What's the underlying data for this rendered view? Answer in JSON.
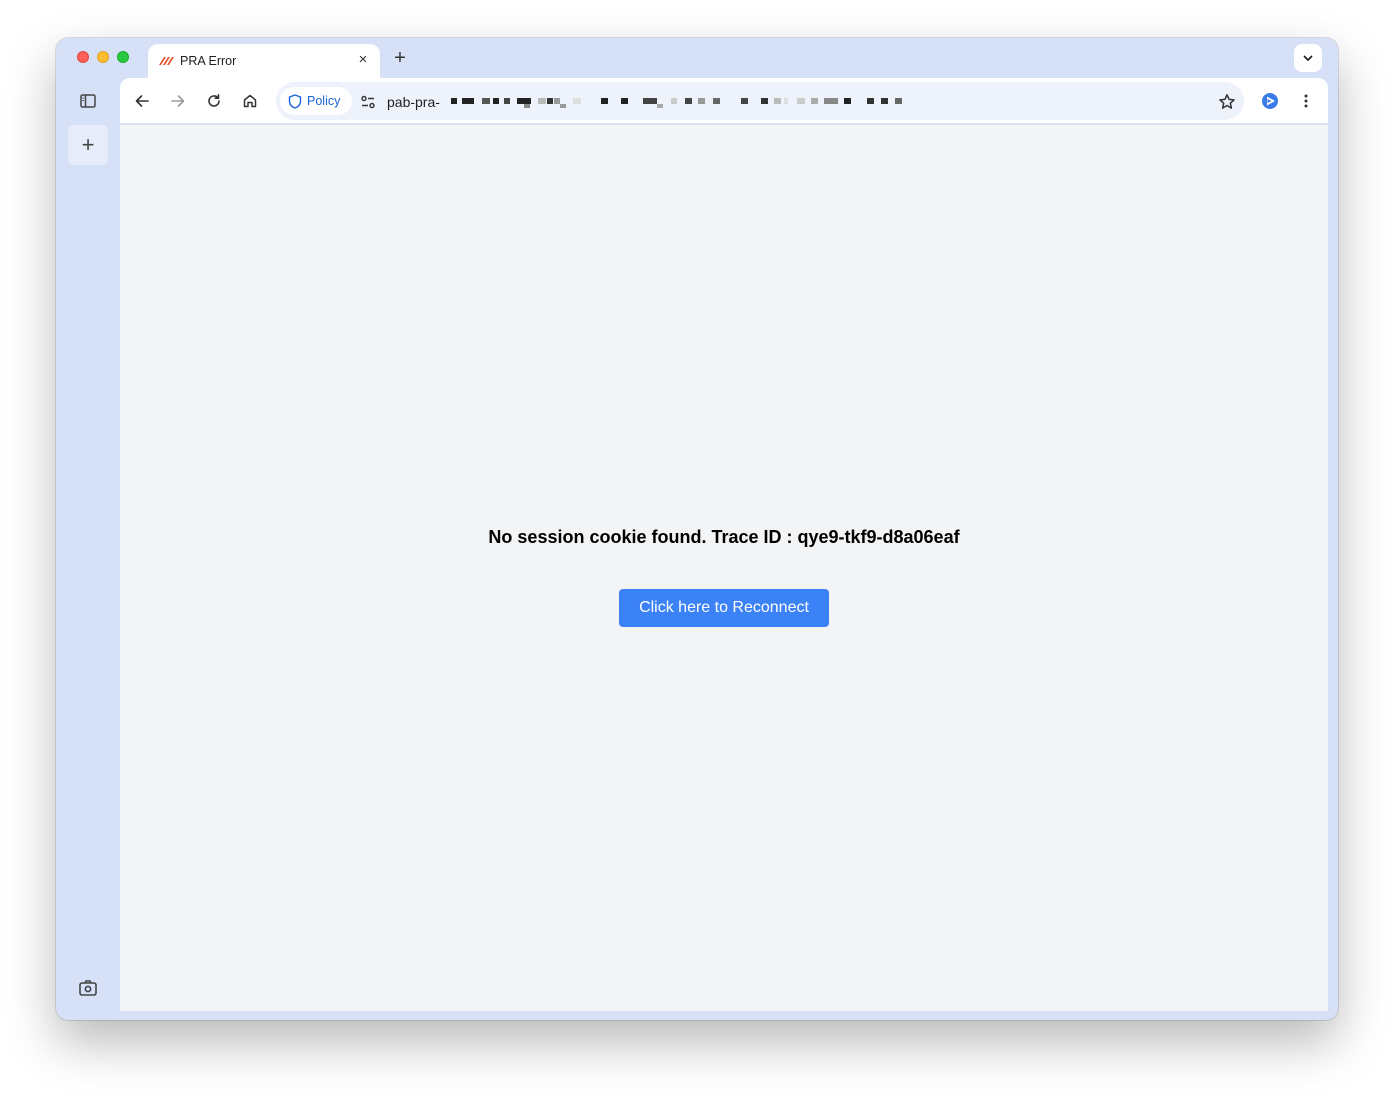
{
  "tab": {
    "title": "PRA Error",
    "close_glyph": "×"
  },
  "toolbar": {
    "new_tab_glyph": "+",
    "policy_label": "Policy",
    "url_prefix": "pab-pra-"
  },
  "sidebar": {
    "add_glyph": "+"
  },
  "page": {
    "message": "No session cookie found. Trace ID : qye9-tkf9-d8a06eaf",
    "reconnect_label": "Click here to Reconnect"
  },
  "icons": {
    "favicon": "slash-logo-icon",
    "search_tabs": "chevron-down-icon",
    "back": "arrow-left-icon",
    "forward": "arrow-right-icon",
    "reload": "reload-icon",
    "home": "home-icon",
    "shield": "shield-icon",
    "tune": "tune-icon",
    "star": "star-icon",
    "extension": "extension-icon",
    "menu": "kebab-menu-icon",
    "sidebar": "sidebar-icon",
    "camera": "camera-icon"
  },
  "colors": {
    "frame": "#d6e0f7",
    "content_bg": "#f3f4f6",
    "button": "#3b82f6",
    "policy_text": "#1a63d6",
    "favicon": "#e8542f"
  }
}
